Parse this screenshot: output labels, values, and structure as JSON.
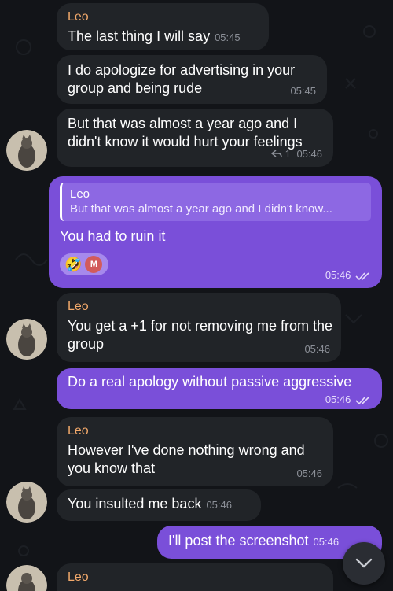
{
  "messages": [
    {
      "sender": "Leo",
      "text": "The last thing I will say",
      "time": "05:45"
    },
    {
      "text": "I do apologize for advertising in your group and being rude",
      "time": "05:45"
    },
    {
      "text": "But that was almost a year ago and I didn't know it would hurt your feelings",
      "reply_count": "1",
      "time": "05:46"
    },
    {
      "quote_name": "Leo",
      "quote_text": "But that was almost a year ago and I didn't know...",
      "text": "You had to ruin it",
      "reaction_emoji": "🤣",
      "reaction_user": "M",
      "time": "05:46"
    },
    {
      "sender": "Leo",
      "text": "You get a +1 for not removing me from the group",
      "time": "05:46"
    },
    {
      "text": "Do a real apology without passive aggressive",
      "time": "05:46"
    },
    {
      "sender": "Leo",
      "text": "However I've done nothing wrong and you know that",
      "time": "05:46"
    },
    {
      "text": "You insulted me back",
      "time": "05:46"
    },
    {
      "text": "I'll post the screenshot",
      "time": "05:46"
    },
    {
      "sender": "Leo"
    }
  ],
  "icons": {
    "reply": "reply-arrow-icon",
    "read": "double-check-icon",
    "scroll": "chevron-down-icon"
  },
  "colors": {
    "background": "#121418",
    "incoming_bubble": "#212428",
    "outgoing_bubble": "#7a4fd9",
    "sender_name": "#f3a96b"
  }
}
